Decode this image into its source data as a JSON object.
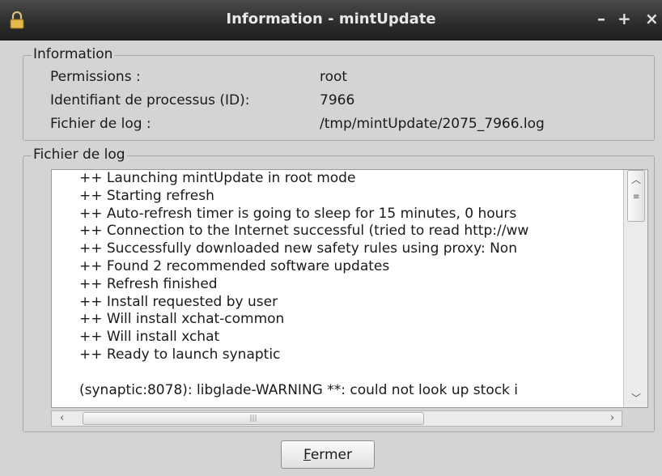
{
  "window": {
    "title": "Information - mintUpdate",
    "controls": {
      "minimize": "–",
      "maximize": "+",
      "close": "×"
    },
    "icon": "lock-icon"
  },
  "info": {
    "legend": "Information",
    "rows": [
      {
        "label": "Permissions :",
        "value": "root"
      },
      {
        "label": "Identifiant de processus (ID):",
        "value": "7966"
      },
      {
        "label": "Fichier de log :",
        "value": "/tmp/mintUpdate/2075_7966.log"
      }
    ]
  },
  "log": {
    "legend": "Fichier de log",
    "lines": [
      "++ Launching mintUpdate in root mode",
      "++ Starting refresh",
      "++ Auto-refresh timer is going to sleep for 15 minutes, 0 hours",
      "++ Connection to the Internet successful (tried to read http://ww",
      "++ Successfully downloaded new safety rules using proxy: Non",
      "++ Found 2 recommended software updates",
      "++ Refresh finished",
      "++ Install requested by user",
      "++ Will install xchat-common",
      "++ Will install xchat",
      "++ Ready to launch synaptic",
      "",
      "(synaptic:8078): libglade-WARNING **: could not look up stock i"
    ],
    "vertical_scroll_position": 0,
    "horizontal_scroll_position": 0.06
  },
  "buttons": {
    "close_mnemonic": "F",
    "close_rest": "ermer"
  }
}
